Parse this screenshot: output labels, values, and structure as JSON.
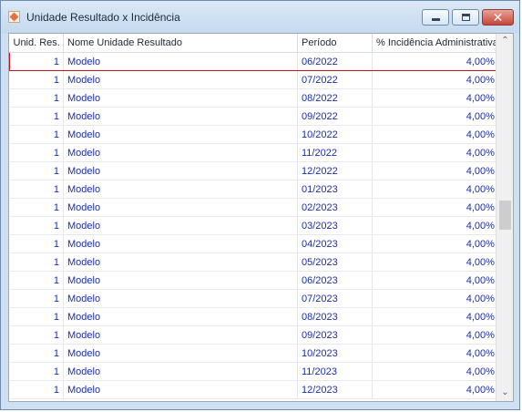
{
  "window": {
    "title": "Unidade Resultado x Incidência",
    "close_label": "✕"
  },
  "grid": {
    "columns": [
      "Unid. Res.",
      "Nome Unidade Resultado",
      "Período",
      "% Incidência Administrativa"
    ],
    "rows": [
      {
        "unid": "1",
        "nome": "Modelo",
        "periodo": "06/2022",
        "incidencia": "4,00%"
      },
      {
        "unid": "1",
        "nome": "Modelo",
        "periodo": "07/2022",
        "incidencia": "4,00%"
      },
      {
        "unid": "1",
        "nome": "Modelo",
        "periodo": "08/2022",
        "incidencia": "4,00%"
      },
      {
        "unid": "1",
        "nome": "Modelo",
        "periodo": "09/2022",
        "incidencia": "4,00%"
      },
      {
        "unid": "1",
        "nome": "Modelo",
        "periodo": "10/2022",
        "incidencia": "4,00%"
      },
      {
        "unid": "1",
        "nome": "Modelo",
        "periodo": "11/2022",
        "incidencia": "4,00%"
      },
      {
        "unid": "1",
        "nome": "Modelo",
        "periodo": "12/2022",
        "incidencia": "4,00%"
      },
      {
        "unid": "1",
        "nome": "Modelo",
        "periodo": "01/2023",
        "incidencia": "4,00%"
      },
      {
        "unid": "1",
        "nome": "Modelo",
        "periodo": "02/2023",
        "incidencia": "4,00%"
      },
      {
        "unid": "1",
        "nome": "Modelo",
        "periodo": "03/2023",
        "incidencia": "4,00%"
      },
      {
        "unid": "1",
        "nome": "Modelo",
        "periodo": "04/2023",
        "incidencia": "4,00%"
      },
      {
        "unid": "1",
        "nome": "Modelo",
        "periodo": "05/2023",
        "incidencia": "4,00%"
      },
      {
        "unid": "1",
        "nome": "Modelo",
        "periodo": "06/2023",
        "incidencia": "4,00%"
      },
      {
        "unid": "1",
        "nome": "Modelo",
        "periodo": "07/2023",
        "incidencia": "4,00%"
      },
      {
        "unid": "1",
        "nome": "Modelo",
        "periodo": "08/2023",
        "incidencia": "4,00%"
      },
      {
        "unid": "1",
        "nome": "Modelo",
        "periodo": "09/2023",
        "incidencia": "4,00%"
      },
      {
        "unid": "1",
        "nome": "Modelo",
        "periodo": "10/2023",
        "incidencia": "4,00%"
      },
      {
        "unid": "1",
        "nome": "Modelo",
        "periodo": "11/2023",
        "incidencia": "4,00%"
      },
      {
        "unid": "1",
        "nome": "Modelo",
        "periodo": "12/2023",
        "incidencia": "4,00%"
      }
    ],
    "selected_row": 0
  },
  "scrollbar": {
    "up_arrow": "⌃",
    "down_arrow": "⌄"
  }
}
